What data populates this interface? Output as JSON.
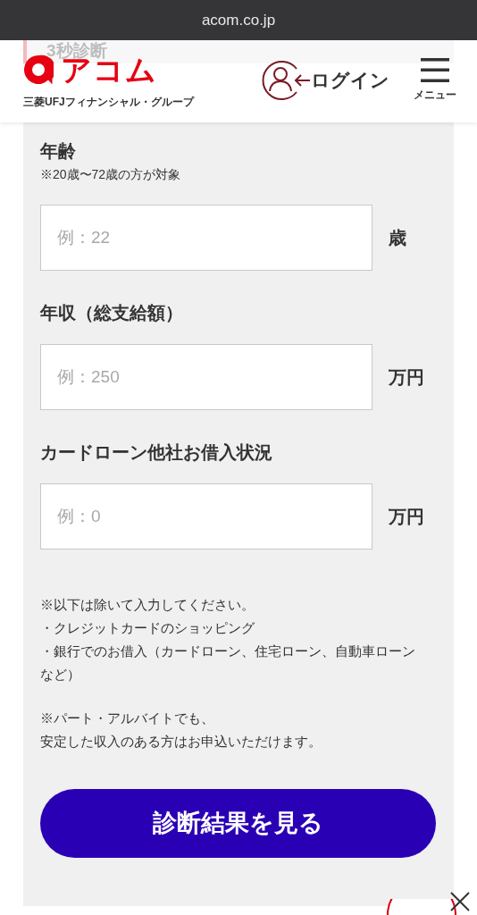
{
  "address_bar": {
    "url": "acom.co.jp"
  },
  "header": {
    "section_peek": "3秒診断",
    "logo_text": "アコム",
    "logo_tagline": "三菱UFJフィナンシャル・グループ",
    "login": "ログイン",
    "menu": "メニュー"
  },
  "fields": [
    {
      "label": "年齢",
      "note": "※20歳〜72歳の方が対象",
      "placeholder": "例：22",
      "unit": "歳"
    },
    {
      "label": "年収（総支給額）",
      "placeholder": "例：250",
      "unit": "万円"
    },
    {
      "label": "カードローン他社お借入状況",
      "placeholder": "例：0",
      "unit": "万円"
    }
  ],
  "notes": [
    [
      "※以下は除いて入力してください。",
      "・クレジットカードのショッピング",
      "・銀行でのお借入（カードローン、住宅ローン、自動車ローンなど）"
    ],
    [
      "※パート・アルバイトでも、",
      "安定した収入のある方はお申込いただけます。"
    ]
  ],
  "submit_button": "診断結果を見る"
}
